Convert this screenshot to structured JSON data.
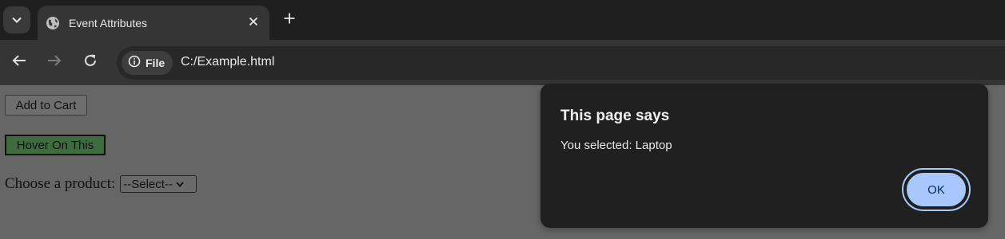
{
  "browser": {
    "tab_title": "Event Attributes",
    "url": "C:/Example.html",
    "site_chip_label": "File",
    "icons": {
      "tab_search": "chevron-down-icon",
      "favicon": "globe-icon",
      "tab_close": "close-icon",
      "new_tab": "plus-icon",
      "back": "arrow-left-icon",
      "forward": "arrow-right-icon",
      "reload": "reload-icon",
      "site_info": "info-icon"
    }
  },
  "page": {
    "add_to_cart_label": "Add to Cart",
    "hover_button_label": "Hover On This",
    "choose_label": "Choose a product:",
    "select_value": "--Select--"
  },
  "dialog": {
    "heading": "This page says",
    "message": "You selected: Laptop",
    "ok_label": "OK"
  },
  "colors": {
    "hover_button_bg": "#3f6c3f",
    "ok_button_bg": "#a8c7fa",
    "dialog_bg": "#202020"
  }
}
